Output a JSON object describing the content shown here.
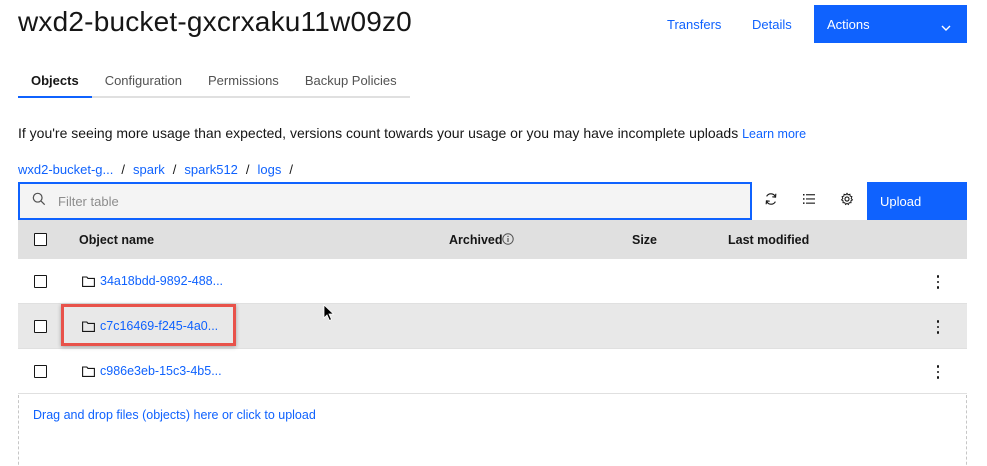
{
  "page": {
    "title": "wxd2-bucket-gxcrxaku11w09z0"
  },
  "header": {
    "transfers_label": "Transfers",
    "details_label": "Details",
    "actions_label": "Actions"
  },
  "tabs": [
    {
      "label": "Objects",
      "active": true
    },
    {
      "label": "Configuration",
      "active": false
    },
    {
      "label": "Permissions",
      "active": false
    },
    {
      "label": "Backup Policies",
      "active": false
    }
  ],
  "notice": {
    "text": "If you're seeing more usage than expected, versions count towards your usage or you may have incomplete uploads",
    "link": "Learn more"
  },
  "breadcrumb": [
    "wxd2-bucket-g...",
    "spark",
    "spark512",
    "logs"
  ],
  "breadcrumb_separator": "/",
  "toolbar": {
    "filter_placeholder": "Filter table",
    "upload_label": "Upload",
    "icons": [
      "search-icon",
      "refresh-icon",
      "list-view-icon",
      "settings-icon"
    ]
  },
  "table": {
    "columns": {
      "name": "Object name",
      "archived": "Archived",
      "size": "Size",
      "modified": "Last modified"
    },
    "rows": [
      {
        "name": "34a18bdd-9892-488...",
        "type": "folder"
      },
      {
        "name": "c7c16469-f245-4a0...",
        "type": "folder"
      },
      {
        "name": "c986e3eb-15c3-4b5...",
        "type": "folder"
      }
    ]
  },
  "dropzone": {
    "text": "Drag and drop files (objects) here or click to upload"
  },
  "colors": {
    "accent": "#0f62fe",
    "highlight": "#e8524a"
  }
}
